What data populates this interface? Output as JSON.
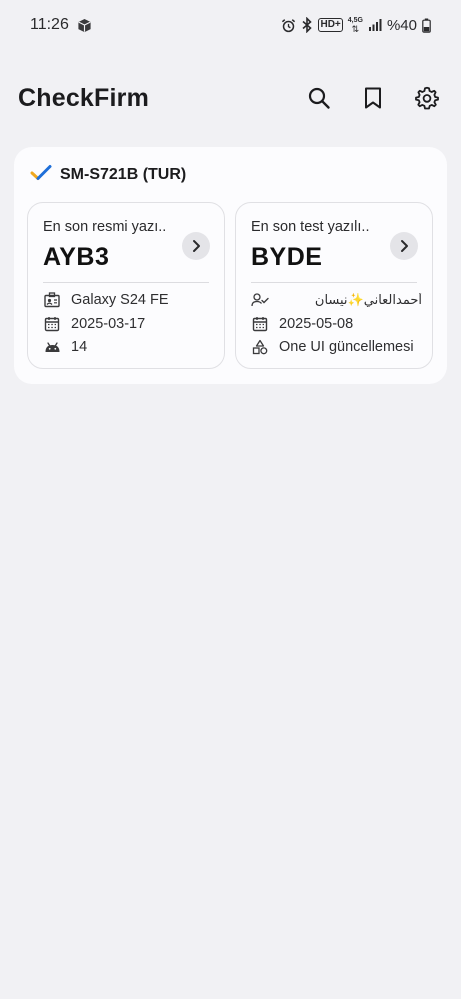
{
  "status_bar": {
    "time": "11:26",
    "network": "HD+",
    "network_gen": "4,5G",
    "battery": "%40",
    "icons": [
      "package-icon",
      "alarm-icon",
      "bluetooth-icon",
      "hd-plus-icon",
      "data-arrows-icon",
      "signal-icon",
      "battery-icon"
    ]
  },
  "header": {
    "title": "CheckFirm",
    "actions": [
      "search-icon",
      "bookmark-icon",
      "settings-gear-icon"
    ]
  },
  "device": {
    "model": "SM-S721B (TUR)",
    "check_colors": [
      "#1e6fd9",
      "#f0a81e"
    ],
    "official": {
      "caption": "En son resmi yazı..",
      "build": "AYB3",
      "rows": [
        {
          "icon": "id-card-icon",
          "text": "Galaxy S24 FE"
        },
        {
          "icon": "calendar-icon",
          "text": "2025-03-17"
        },
        {
          "icon": "android-icon",
          "text": "14"
        }
      ]
    },
    "test": {
      "caption": "En son test yazılı..",
      "build": "BYDE",
      "rows": [
        {
          "icon": "user-check-icon",
          "text": "أحمدالعاني✨نيسان"
        },
        {
          "icon": "calendar-icon",
          "text": "2025-05-08"
        },
        {
          "icon": "shapes-icon",
          "text": "One UI güncellemesi"
        }
      ]
    }
  }
}
